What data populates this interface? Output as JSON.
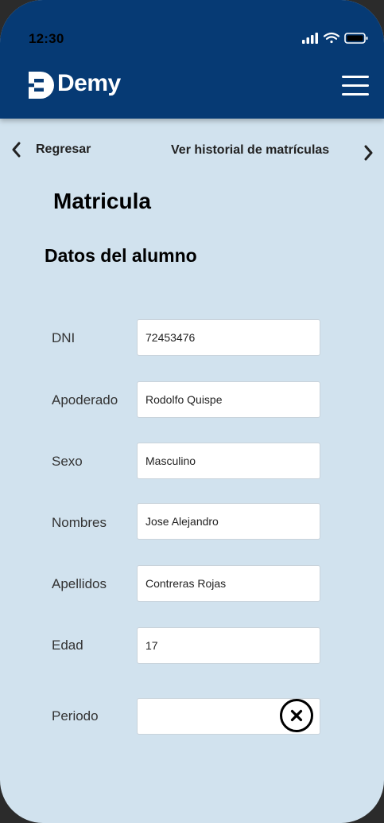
{
  "status_bar": {
    "time": "12:30",
    "icons": [
      "signal-icon",
      "wifi-icon",
      "battery-icon"
    ]
  },
  "header": {
    "brand": "Demy",
    "logo_icon": "demy-logo-icon",
    "menu_icon": "hamburger-menu-icon",
    "background_color": "#063a74"
  },
  "nav": {
    "back_label": "Regresar",
    "history_label": "Ver historial  de matrículas"
  },
  "page": {
    "title": "Matricula",
    "section_title": "Datos del alumno",
    "background_color": "#d1e2ee"
  },
  "form": {
    "fields": [
      {
        "label": "DNI",
        "value": "72453476"
      },
      {
        "label": "Apoderado",
        "value": "Rodolfo Quispe"
      },
      {
        "label": "Sexo",
        "value": "Masculino"
      },
      {
        "label": "Nombres",
        "value": "Jose Alejandro"
      },
      {
        "label": "Apellidos",
        "value": "Contreras Rojas"
      },
      {
        "label": "Edad",
        "value": "17"
      },
      {
        "label": "Periodo",
        "value": ""
      }
    ],
    "clear_icon": "close-circle-icon"
  }
}
